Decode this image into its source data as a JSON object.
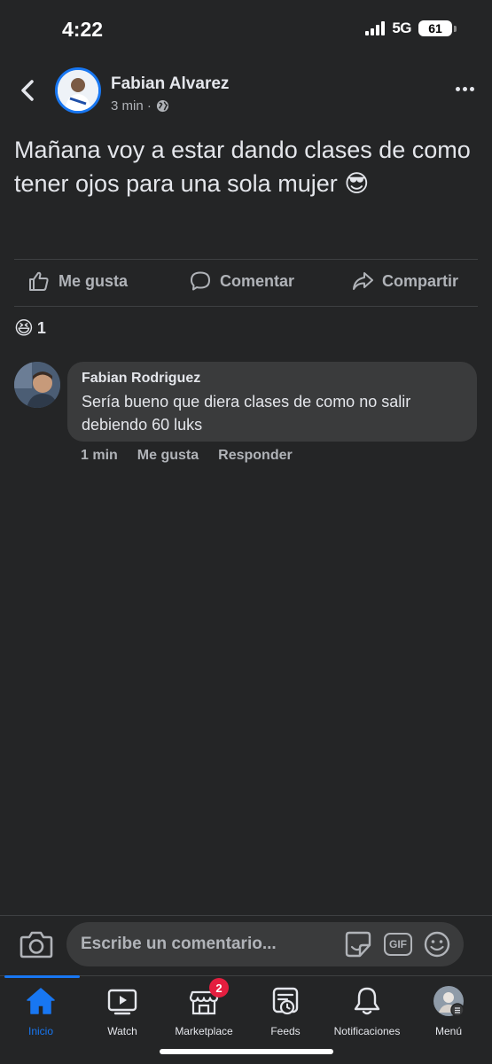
{
  "status_bar": {
    "time": "4:22",
    "network": "5G",
    "battery": "61"
  },
  "post": {
    "author": "Fabian Alvarez",
    "timestamp": "3 min ·",
    "text": "Mañana voy a estar dando clases de como tener ojos para una sola mujer 😎",
    "actions": {
      "like": "Me gusta",
      "comment": "Comentar",
      "share": "Compartir"
    },
    "reactions": {
      "emoji": "😆",
      "count": "1"
    }
  },
  "comments": [
    {
      "author": "Fabian Rodriguez",
      "text": "Sería bueno que diera clases de como no salir debiendo 60 luks",
      "time": "1 min",
      "like": "Me gusta",
      "reply": "Responder"
    }
  ],
  "composer": {
    "placeholder": "Escribe un comentario...",
    "gif": "GIF"
  },
  "tabs": [
    {
      "label": "Inicio",
      "icon": "home-icon",
      "active": true
    },
    {
      "label": "Watch",
      "icon": "video-icon"
    },
    {
      "label": "Marketplace",
      "icon": "marketplace-icon",
      "badge": "2"
    },
    {
      "label": "Feeds",
      "icon": "feeds-icon"
    },
    {
      "label": "Notificaciones",
      "icon": "bell-icon"
    },
    {
      "label": "Menú",
      "icon": "profile-menu-icon"
    }
  ],
  "colors": {
    "accent": "#1877f2",
    "background": "#242526",
    "bubble": "#3a3b3c",
    "badge": "#e41e3f"
  }
}
